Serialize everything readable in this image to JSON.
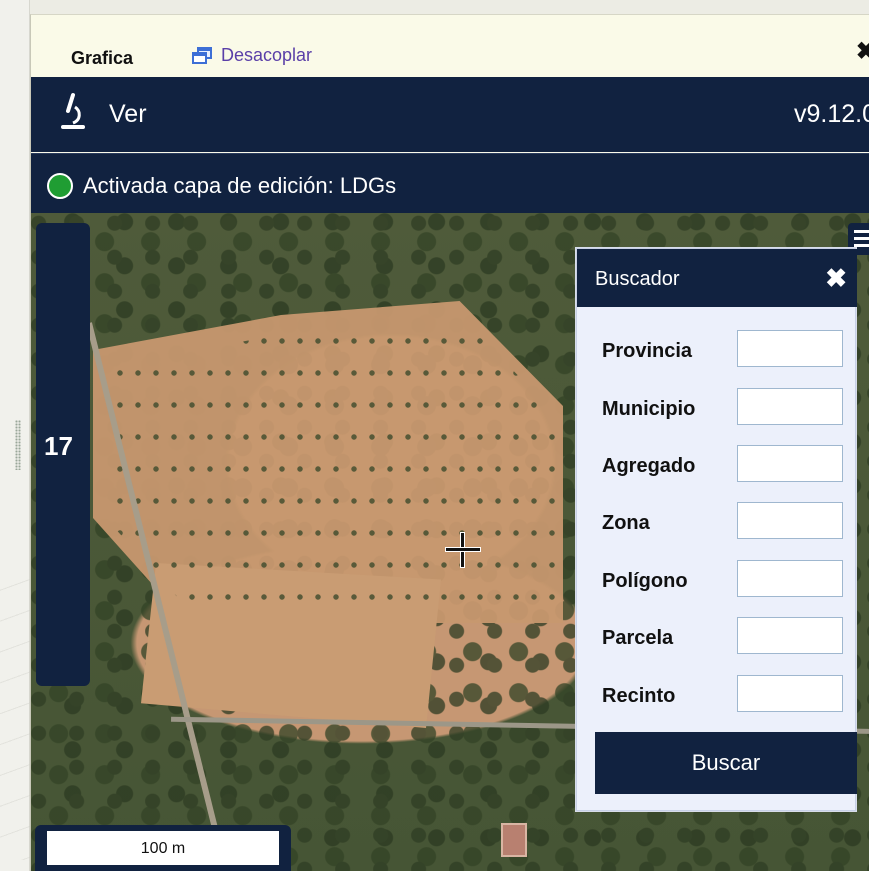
{
  "tabs": {
    "active_tab": "Grafica",
    "undock_label": "Desacoplar",
    "close_icon": "close-icon"
  },
  "toolbar": {
    "menu_label": "Ver",
    "version": "v9.12.0"
  },
  "status": {
    "text": "Activada capa de edición: LDGs",
    "color": "#1f9d33"
  },
  "map": {
    "zoom_level": "17",
    "scale_label": "100 m"
  },
  "search": {
    "title": "Buscador",
    "fields": [
      {
        "label": "Provincia",
        "value": ""
      },
      {
        "label": "Municipio",
        "value": ""
      },
      {
        "label": "Agregado",
        "value": ""
      },
      {
        "label": "Zona",
        "value": ""
      },
      {
        "label": "Polígono",
        "value": ""
      },
      {
        "label": "Parcela",
        "value": ""
      },
      {
        "label": "Recinto",
        "value": ""
      }
    ],
    "submit_label": "Buscar"
  },
  "colors": {
    "navy": "#112240",
    "link": "#5a3fa8"
  }
}
